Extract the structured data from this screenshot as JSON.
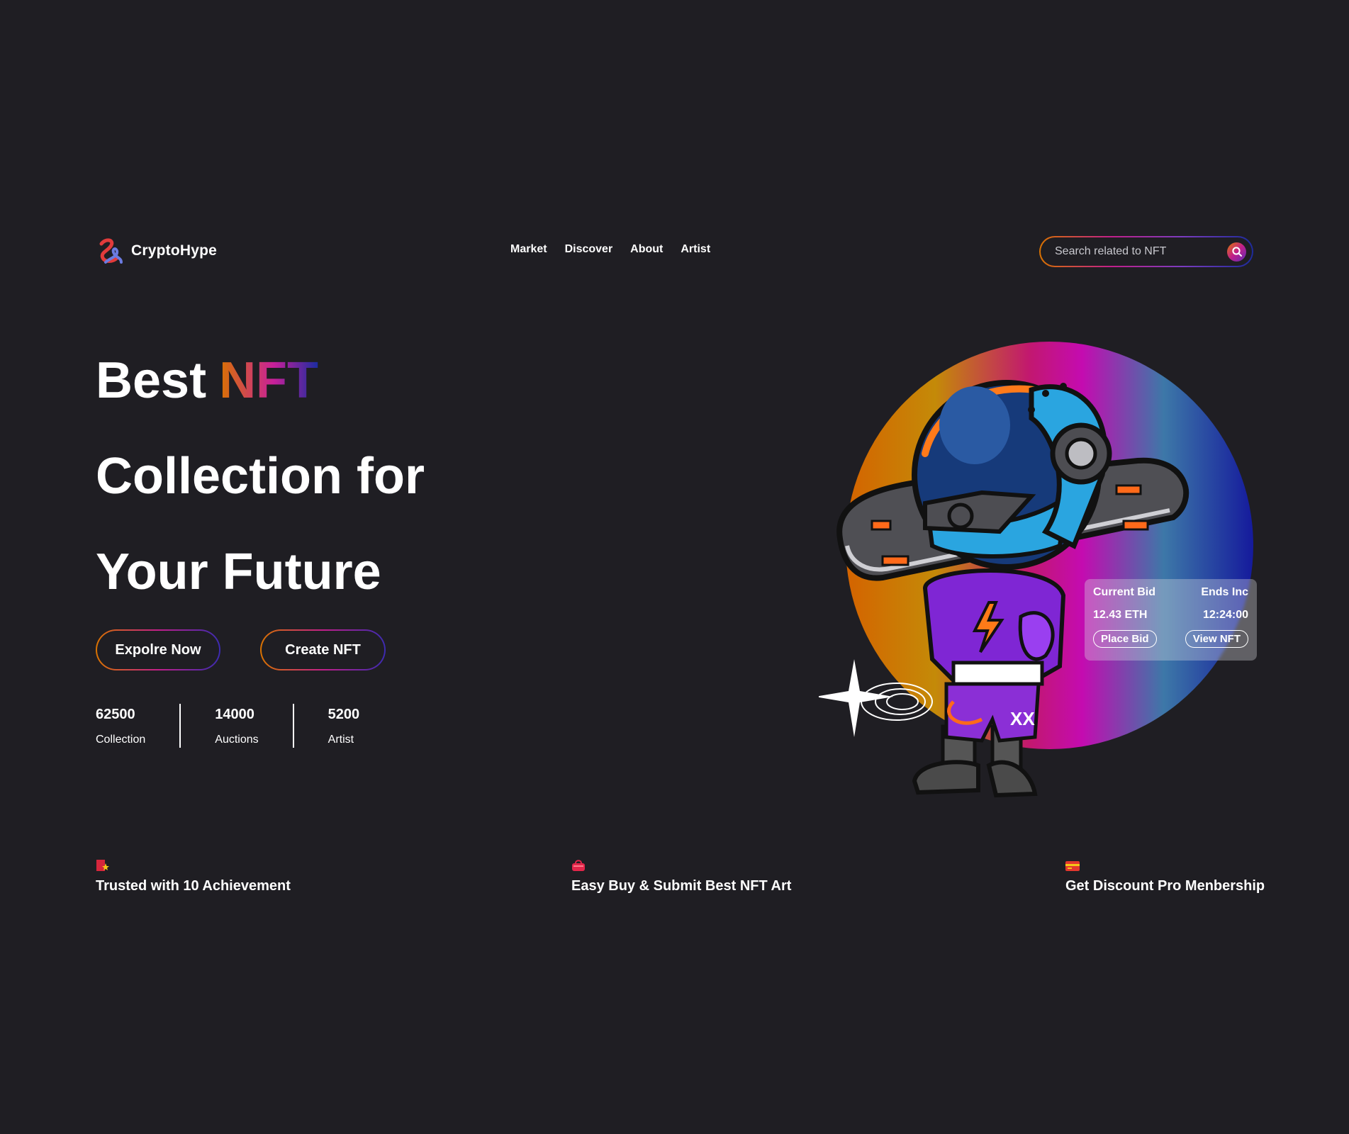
{
  "brand": {
    "name": "CryptoHype",
    "logo_icon": "swirl-logo-icon"
  },
  "nav": {
    "items": [
      {
        "label": "Market"
      },
      {
        "label": "Discover"
      },
      {
        "label": "About"
      },
      {
        "label": "Artist"
      }
    ]
  },
  "search": {
    "placeholder": "Search related to NFT",
    "icon": "search-icon"
  },
  "hero": {
    "title_word1": "Best",
    "title_highlight": "NFT",
    "title_line2": "Collection for",
    "title_line3": "Your Future"
  },
  "buttons": {
    "explore": "Expolre Now",
    "create": "Create NFT"
  },
  "stats": [
    {
      "value": "62500",
      "label": "Collection"
    },
    {
      "value": "14000",
      "label": "Auctions"
    },
    {
      "value": "5200",
      "label": "Artist"
    }
  ],
  "bid_card": {
    "current_bid_label": "Current Bid",
    "ends_label": "Ends Inc",
    "bid_value": "12.43 ETH",
    "time_value": "12:24:00",
    "place_bid": "Place Bid",
    "view_nft": "View NFT"
  },
  "features": [
    {
      "icon": "achievement-badge-icon",
      "text": "Trusted with 10 Achievement"
    },
    {
      "icon": "shopping-bag-icon",
      "text": "Easy Buy & Submit Best NFT Art"
    },
    {
      "icon": "credit-card-icon",
      "text": "Get Discount Pro Menbership"
    }
  ],
  "colors": {
    "background": "#1f1e23",
    "accent_orange": "#d97300",
    "accent_magenta": "#c21f8a",
    "accent_blue": "#1d2b9a"
  }
}
